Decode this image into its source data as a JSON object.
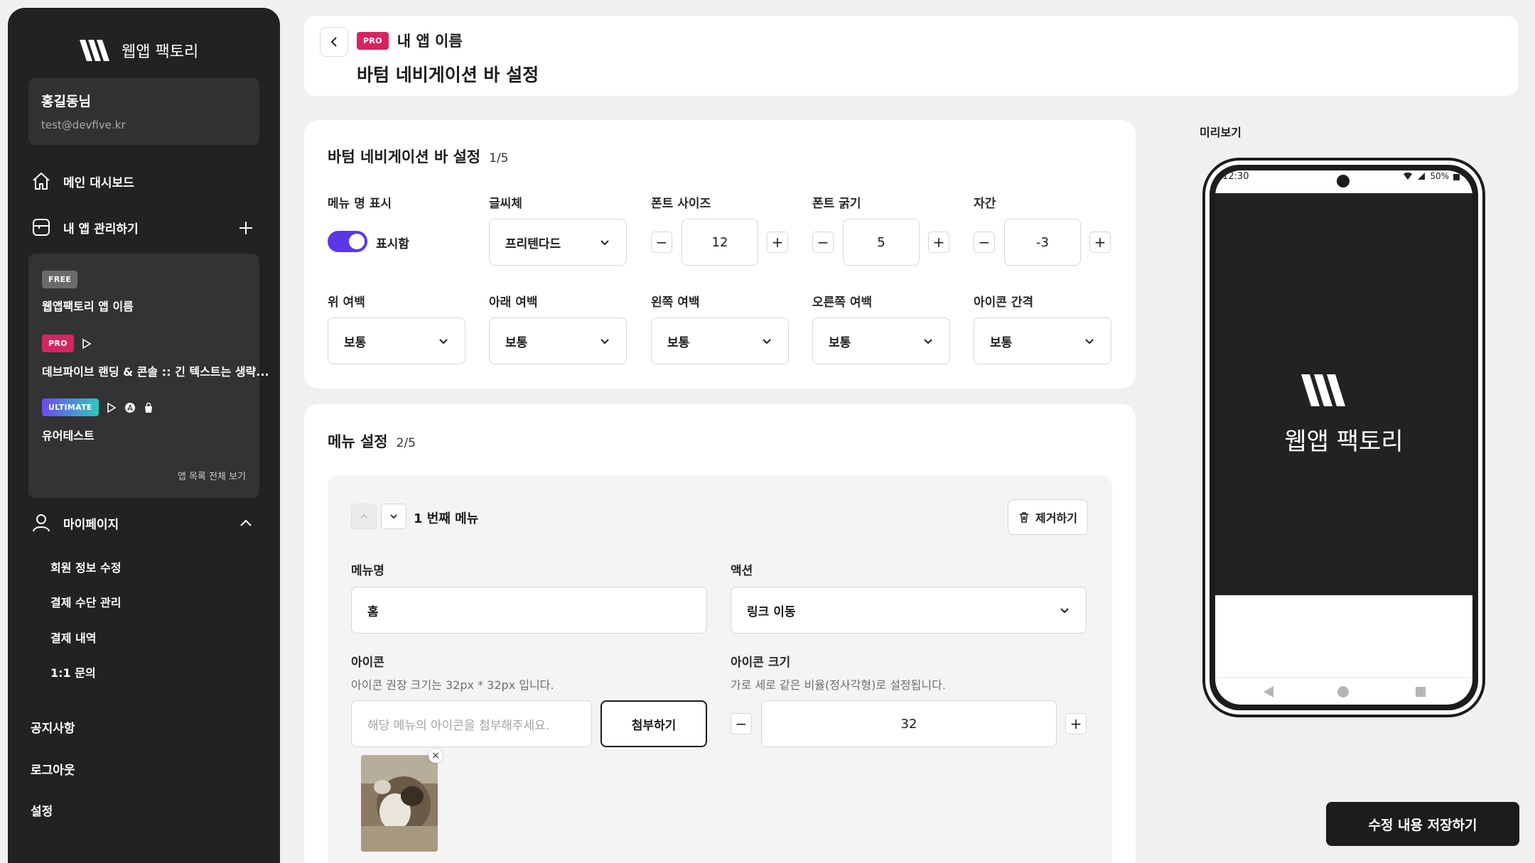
{
  "brand": {
    "name": "웹앱 팩토리"
  },
  "user": {
    "name": "홍길동님",
    "email": "test@devfive.kr"
  },
  "nav": {
    "dashboard": "메인 대시보드",
    "my_apps": "내 앱 관리하기",
    "mypage": "마이페이지",
    "mypage_items": [
      "회원 정보 수정",
      "결제 수단 관리",
      "결제 내역",
      "1:1 문의"
    ],
    "notice": "공지사항",
    "logout": "로그아웃",
    "settings": "설정"
  },
  "apps": {
    "list": [
      {
        "badge": "FREE",
        "name": "웹앱팩토리 앱 이름",
        "platforms": []
      },
      {
        "badge": "PRO",
        "name": "데브파이브 랜딩 & 콘솔 :: 긴 텍스트는 생략...",
        "platforms": [
          "play-store-icon"
        ]
      },
      {
        "badge": "ULTIMATE",
        "name": "유어테스트",
        "platforms": [
          "play-store-icon",
          "app-store-icon",
          "shopping-bag-icon"
        ]
      }
    ],
    "view_all": "앱 목록 전체 보기"
  },
  "header": {
    "badge": "PRO",
    "app_name": "내 앱 이름",
    "title": "바텀 네비게이션 바 설정"
  },
  "section1": {
    "title": "바텀 네비게이션 바 설정",
    "step": "1/5",
    "show_menu_label": "메뉴 명 표시",
    "show_menu_value": "표시함",
    "show_menu_on": true,
    "font_label": "글씨체",
    "font_value": "프리텐다드",
    "font_size_label": "폰트 사이즈",
    "font_size_value": "12",
    "font_weight_label": "폰트 굵기",
    "font_weight_value": "5",
    "letter_spacing_label": "자간",
    "letter_spacing_value": "-3",
    "top_margin_label": "위 여백",
    "top_margin_value": "보통",
    "bottom_margin_label": "아래 여백",
    "bottom_margin_value": "보통",
    "left_margin_label": "왼쪽 여백",
    "left_margin_value": "보통",
    "right_margin_label": "오른쪽 여백",
    "right_margin_value": "보통",
    "icon_gap_label": "아이콘 간격",
    "icon_gap_value": "보통"
  },
  "section2": {
    "title": "메뉴 설정",
    "step": "2/5",
    "menu_item": {
      "number_label": "1 번째 메뉴",
      "remove_label": "제거하기",
      "name_label": "메뉴명",
      "name_value": "홈",
      "action_label": "액션",
      "action_value": "링크 이동",
      "icon_label": "아이콘",
      "icon_desc": "아이콘 권장 크기는 32px * 32px 입니다.",
      "icon_placeholder": "해당 메뉴의 아이콘을 첨부해주세요.",
      "attach_label": "첨부하기",
      "icon_size_label": "아이콘 크기",
      "icon_size_desc": "가로 세로 같은 비율(정사각형)로 설정됩니다.",
      "icon_size_value": "32"
    }
  },
  "preview": {
    "label": "미리보기",
    "status_time": "12:30",
    "status_battery": "50%",
    "app_name": "웹앱 팩토리"
  },
  "save_label": "수정 내용 저장하기",
  "colors": {
    "accent": "#5b37e8",
    "pro": "#d6245f",
    "dark": "#1c1c1e",
    "sidebar": "#222224"
  }
}
